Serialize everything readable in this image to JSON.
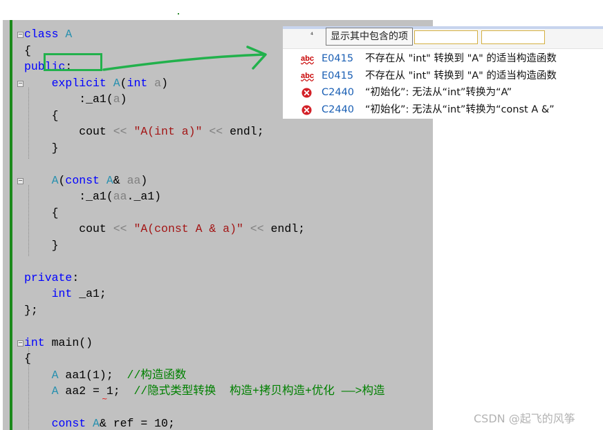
{
  "editor": {
    "lines": [
      {
        "segments": [
          {
            "t": "class ",
            "c": "kw"
          },
          {
            "t": "A",
            "c": "cls"
          }
        ]
      },
      {
        "segments": [
          {
            "t": "{",
            "c": ""
          }
        ]
      },
      {
        "segments": [
          {
            "t": "public",
            "c": "kw"
          },
          {
            "t": ":",
            "c": ""
          }
        ]
      },
      {
        "segments": [
          {
            "t": "    ",
            "c": ""
          },
          {
            "t": "explicit",
            "c": "kw"
          },
          {
            "t": " ",
            "c": ""
          },
          {
            "t": "A",
            "c": "cls"
          },
          {
            "t": "(",
            "c": ""
          },
          {
            "t": "int",
            "c": "kw"
          },
          {
            "t": " ",
            "c": ""
          },
          {
            "t": "a",
            "c": "par"
          },
          {
            "t": ")",
            "c": ""
          }
        ]
      },
      {
        "segments": [
          {
            "t": "        :_a1(",
            "c": ""
          },
          {
            "t": "a",
            "c": "par"
          },
          {
            "t": ")",
            "c": ""
          }
        ]
      },
      {
        "segments": [
          {
            "t": "    {",
            "c": ""
          }
        ]
      },
      {
        "segments": [
          {
            "t": "        cout ",
            "c": ""
          },
          {
            "t": "<<",
            "c": "op"
          },
          {
            "t": " ",
            "c": ""
          },
          {
            "t": "\"A(int a)\"",
            "c": "str"
          },
          {
            "t": " ",
            "c": ""
          },
          {
            "t": "<<",
            "c": "op"
          },
          {
            "t": " endl;",
            "c": ""
          }
        ]
      },
      {
        "segments": [
          {
            "t": "    }",
            "c": ""
          }
        ]
      },
      {
        "segments": [
          {
            "t": "",
            "c": ""
          }
        ]
      },
      {
        "segments": [
          {
            "t": "    ",
            "c": ""
          },
          {
            "t": "A",
            "c": "cls"
          },
          {
            "t": "(",
            "c": ""
          },
          {
            "t": "const",
            "c": "kw"
          },
          {
            "t": " ",
            "c": ""
          },
          {
            "t": "A",
            "c": "cls"
          },
          {
            "t": "& ",
            "c": ""
          },
          {
            "t": "aa",
            "c": "par"
          },
          {
            "t": ")",
            "c": ""
          }
        ]
      },
      {
        "segments": [
          {
            "t": "        :_a1(",
            "c": ""
          },
          {
            "t": "aa",
            "c": "par"
          },
          {
            "t": "._a1)",
            "c": ""
          }
        ]
      },
      {
        "segments": [
          {
            "t": "    {",
            "c": ""
          }
        ]
      },
      {
        "segments": [
          {
            "t": "        cout ",
            "c": ""
          },
          {
            "t": "<<",
            "c": "op"
          },
          {
            "t": " ",
            "c": ""
          },
          {
            "t": "\"A(const A & a)\"",
            "c": "str"
          },
          {
            "t": " ",
            "c": ""
          },
          {
            "t": "<<",
            "c": "op"
          },
          {
            "t": " endl;",
            "c": ""
          }
        ]
      },
      {
        "segments": [
          {
            "t": "    }",
            "c": ""
          }
        ]
      },
      {
        "segments": [
          {
            "t": "",
            "c": ""
          }
        ]
      },
      {
        "segments": [
          {
            "t": "private",
            "c": "kw"
          },
          {
            "t": ":",
            "c": ""
          }
        ]
      },
      {
        "segments": [
          {
            "t": "    ",
            "c": ""
          },
          {
            "t": "int",
            "c": "kw"
          },
          {
            "t": " _a1;",
            "c": ""
          }
        ]
      },
      {
        "segments": [
          {
            "t": "};",
            "c": ""
          }
        ]
      },
      {
        "segments": [
          {
            "t": "",
            "c": ""
          }
        ]
      },
      {
        "segments": [
          {
            "t": "int",
            "c": "kw"
          },
          {
            "t": " main()",
            "c": ""
          }
        ]
      },
      {
        "segments": [
          {
            "t": "{",
            "c": ""
          }
        ]
      },
      {
        "segments": [
          {
            "t": "    ",
            "c": ""
          },
          {
            "t": "A",
            "c": "cls"
          },
          {
            "t": " aa1(1);  ",
            "c": ""
          },
          {
            "t": "//构造函数",
            "c": "cmt"
          }
        ]
      },
      {
        "segments": [
          {
            "t": "    ",
            "c": ""
          },
          {
            "t": "A",
            "c": "cls"
          },
          {
            "t": " aa2 = 1;  ",
            "c": ""
          },
          {
            "t": "//隐式类型转换  构造+拷贝构造+优化 ——>构造",
            "c": "cmt"
          }
        ]
      },
      {
        "segments": [
          {
            "t": "",
            "c": ""
          }
        ]
      },
      {
        "segments": [
          {
            "t": "    ",
            "c": ""
          },
          {
            "t": "const",
            "c": "kw"
          },
          {
            "t": " ",
            "c": ""
          },
          {
            "t": "A",
            "c": "cls"
          },
          {
            "t": "& ref = 10;",
            "c": ""
          }
        ]
      }
    ]
  },
  "error_list": {
    "tooltip": "显示其中包含的项",
    "header_icon": "⁴",
    "rows": [
      {
        "icon": "spell-error-icon",
        "code": "E0415",
        "description": "不存在从 \"int\" 转换到 \"A\" 的适当构造函数"
      },
      {
        "icon": "spell-error-icon",
        "code": "E0415",
        "description": "不存在从 \"int\" 转换到 \"A\" 的适当构造函数"
      },
      {
        "icon": "error-circle-icon",
        "code": "C2440",
        "description": "“初始化”: 无法从“int”转换为“A”"
      },
      {
        "icon": "error-circle-icon",
        "code": "C2440",
        "description": "“初始化”: 无法从“int”转换为“const A &”"
      }
    ]
  },
  "colors": {
    "keyword": "#0000ff",
    "class": "#2b91af",
    "string": "#a31515",
    "comment": "#008000",
    "error": "#d32027",
    "highlight_box": "#22b14c"
  },
  "watermark": "CSDN @起飞的风筝"
}
